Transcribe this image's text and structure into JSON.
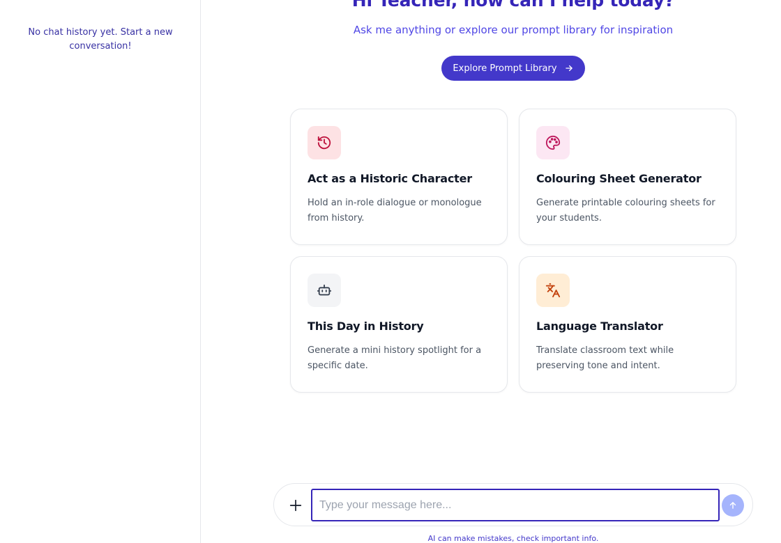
{
  "sidebar": {
    "empty_message": "No chat history yet. Start a new conversation!"
  },
  "hero": {
    "greeting": "Hi Teacher, how can I help today?",
    "subtitle": "Ask me anything or explore our prompt library for inspiration",
    "explore_button_label": "Explore Prompt Library",
    "explore_button_icon": "arrow-right-icon"
  },
  "cards": [
    {
      "title": "Act as a Historic Character",
      "description": "Hold an in-role dialogue or monologue from history.",
      "icon": "history-icon",
      "icon_bg": "#fde2e4",
      "icon_color": "#be123c"
    },
    {
      "title": "Colouring Sheet Generator",
      "description": "Generate printable colouring sheets for your students.",
      "icon": "palette-icon",
      "icon_bg": "#fce7f3",
      "icon_color": "#be185d"
    },
    {
      "title": "This Day in History",
      "description": "Generate a mini history spotlight for a specific date.",
      "icon": "bot-icon",
      "icon_bg": "#f3f4f6",
      "icon_color": "#374151"
    },
    {
      "title": "Language Translator",
      "description": "Translate classroom text while preserving tone and intent.",
      "icon": "translate-icon",
      "icon_bg": "#ffedd5",
      "icon_color": "#c2410c"
    }
  ],
  "composer": {
    "placeholder": "Type your message here...",
    "value": "",
    "attach_icon": "plus-icon",
    "send_icon": "arrow-up-icon"
  },
  "footer": {
    "disclaimer": "AI can make mistakes, check important info."
  },
  "colors": {
    "accent": "#4338ca",
    "heading": "#3525b8",
    "send_button_disabled": "#a5b4fc"
  }
}
